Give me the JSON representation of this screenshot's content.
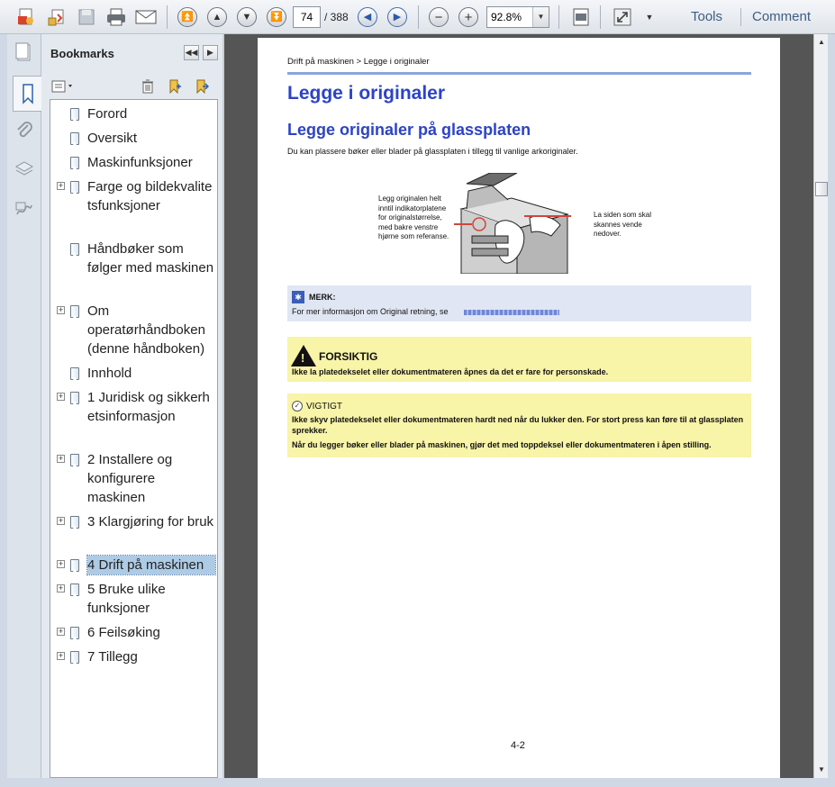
{
  "toolbar": {
    "page_current": "74",
    "page_total": "/ 388",
    "zoom": "92.8%",
    "tools_label": "Tools",
    "comment_label": "Comment"
  },
  "bookmarks": {
    "title": "Bookmarks",
    "items": [
      {
        "label": "Forord",
        "expandable": false
      },
      {
        "label": "Oversikt",
        "expandable": false
      },
      {
        "label": "Maskinfunksjoner",
        "expandable": false
      },
      {
        "label": "Farge og bildekvalitetsfunksjoner",
        "expandable": true
      },
      {
        "label": "Håndbøker som følger med maskinen",
        "expandable": false
      },
      {
        "label": "Om operatørhåndboken (denne håndboken)",
        "expandable": true
      },
      {
        "label": "Innhold",
        "expandable": false
      },
      {
        "label": "1 Juridisk og sikkerhetsinformasjon",
        "expandable": true
      },
      {
        "label": "2 Installere og konfigurere maskinen",
        "expandable": true
      },
      {
        "label": "3 Klargjøring for bruk",
        "expandable": true
      },
      {
        "label": "4 Drift på maskinen",
        "expandable": true,
        "selected": true
      },
      {
        "label": "5 Bruke ulike funksjoner",
        "expandable": true
      },
      {
        "label": "6 Feilsøking",
        "expandable": true
      },
      {
        "label": "7 Tillegg",
        "expandable": true
      }
    ]
  },
  "document": {
    "breadcrumb": "Drift på maskinen > Legge i originaler",
    "heading1": "Legge i originaler",
    "heading2": "Legge originaler på glassplaten",
    "intro": "Du kan plassere bøker eller blader på glassplaten i tillegg til vanlige arkoriginaler.",
    "figure_left_label": "Legg originalen helt inntil indikatorplatene for originalstørrelse, med bakre venstre hjørne som referanse.",
    "figure_right_label": "La siden som skal skannes vende nedover.",
    "note_title": "MERK:",
    "note_text": "For mer informasjon om Original retning, se",
    "caution_title": "FORSIKTIG",
    "caution_text": "Ikke la platedekselet eller dokumentmateren åpnes da det er fare for personskade.",
    "important_title": "VIGTIGT",
    "important_text1": "Ikke skyv platedekselet eller dokumentmateren hardt ned når du lukker den. For stort press kan føre til at glassplaten sprekker.",
    "important_text2": "Når du legger bøker eller blader på maskinen, gjør det med toppdeksel eller dokumentmateren i åpen stilling.",
    "page_number": "4-2"
  },
  "colors": {
    "heading": "#2c43c8",
    "note_bg": "#e0e6f3",
    "caution_bg": "#f8f4a8",
    "selection": "#aecbe6"
  }
}
